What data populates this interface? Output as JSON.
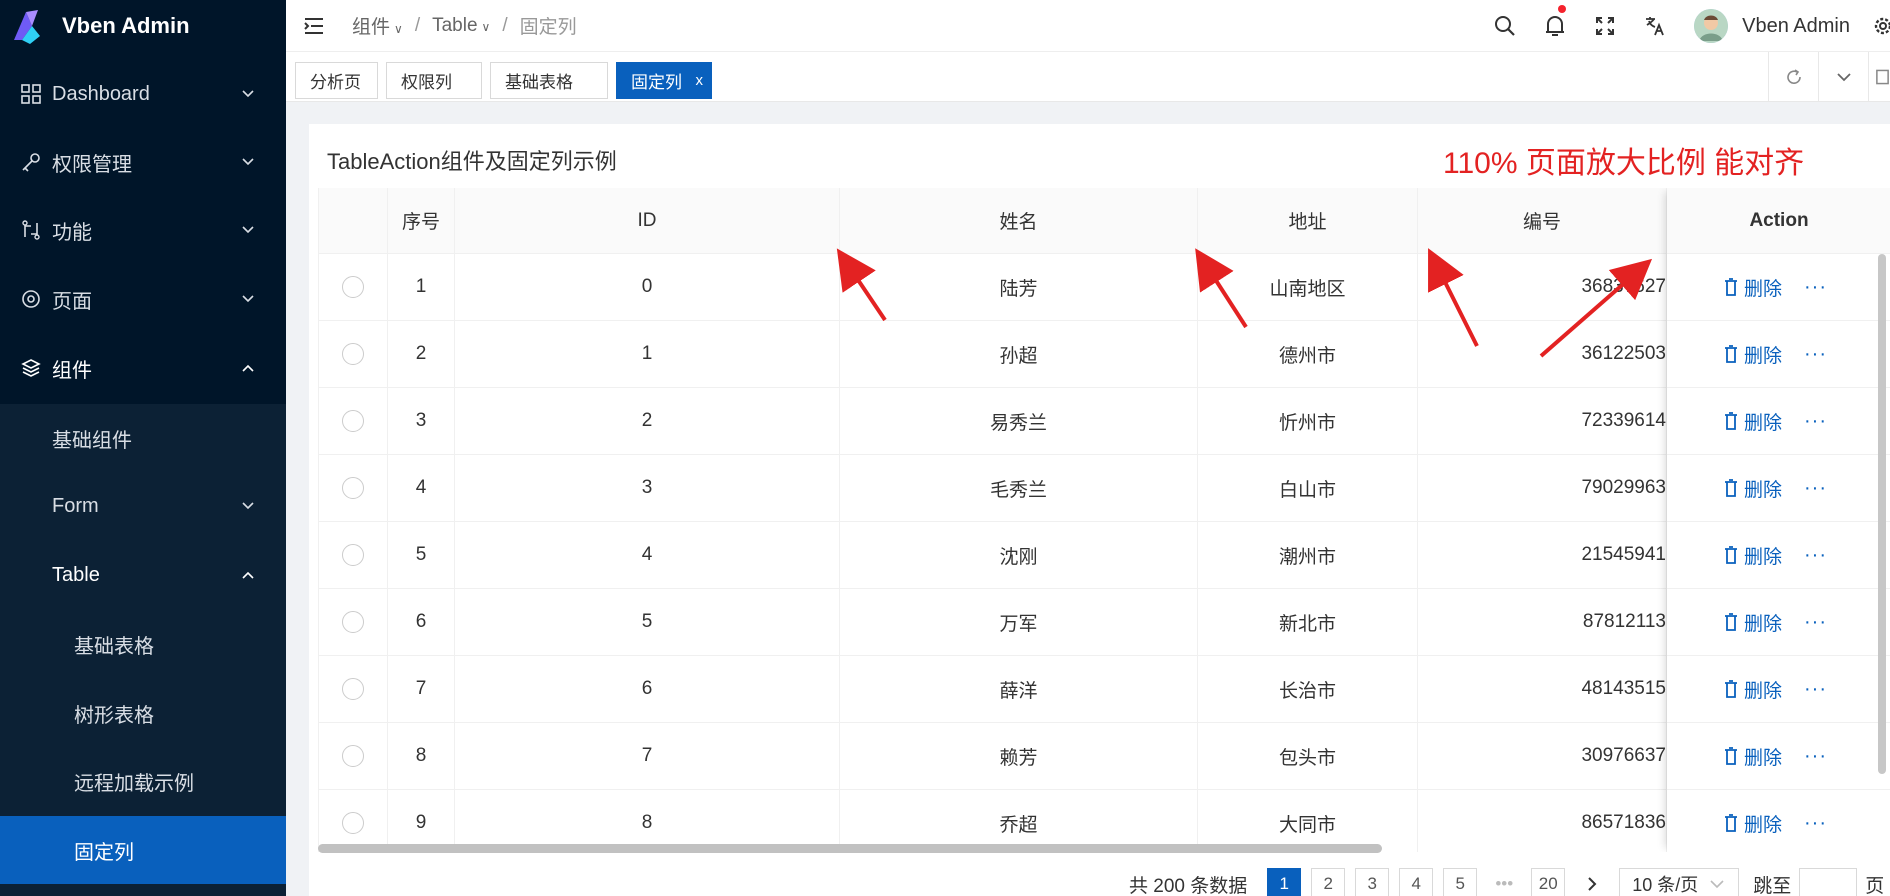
{
  "app": {
    "title": "Vben Admin"
  },
  "sidebar": {
    "items": [
      {
        "label": "Dashboard",
        "icon": "dashboard-icon"
      },
      {
        "label": "权限管理",
        "icon": "key-icon"
      },
      {
        "label": "功能",
        "icon": "function-icon"
      },
      {
        "label": "页面",
        "icon": "page-icon"
      },
      {
        "label": "组件",
        "icon": "layers-icon"
      },
      {
        "label": "基础组件"
      },
      {
        "label": "Form"
      },
      {
        "label": "Table"
      },
      {
        "label": "基础表格"
      },
      {
        "label": "树形表格"
      },
      {
        "label": "远程加载示例"
      },
      {
        "label": "固定列"
      }
    ]
  },
  "header": {
    "breadcrumb": [
      "组件",
      "Table",
      "固定列"
    ],
    "user": "Vben Admin"
  },
  "tabs": [
    {
      "label": "分析页"
    },
    {
      "label": "权限列"
    },
    {
      "label": "基础表格"
    },
    {
      "label": "固定列",
      "close": "x"
    }
  ],
  "card": {
    "title": "TableAction组件及固定列示例",
    "annotation": "110% 页面放大比例 能对齐"
  },
  "table": {
    "headers": [
      "序号",
      "ID",
      "姓名",
      "地址",
      "编号",
      "Action"
    ],
    "delete_label": "删除",
    "more_label": "···",
    "rows": [
      {
        "no": "1",
        "id": "0",
        "name": "陆芳",
        "addr": "山南地区",
        "code": "36837627"
      },
      {
        "no": "2",
        "id": "1",
        "name": "孙超",
        "addr": "德州市",
        "code": "36122503"
      },
      {
        "no": "3",
        "id": "2",
        "name": "易秀兰",
        "addr": "忻州市",
        "code": "72339614"
      },
      {
        "no": "4",
        "id": "3",
        "name": "毛秀兰",
        "addr": "白山市",
        "code": "79029963"
      },
      {
        "no": "5",
        "id": "4",
        "name": "沈刚",
        "addr": "潮州市",
        "code": "21545941"
      },
      {
        "no": "6",
        "id": "5",
        "name": "万军",
        "addr": "新北市",
        "code": "87812113"
      },
      {
        "no": "7",
        "id": "6",
        "name": "薛洋",
        "addr": "长治市",
        "code": "48143515"
      },
      {
        "no": "8",
        "id": "7",
        "name": "赖芳",
        "addr": "包头市",
        "code": "30976637"
      },
      {
        "no": "9",
        "id": "8",
        "name": "乔超",
        "addr": "大同市",
        "code": "86571836"
      }
    ]
  },
  "pager": {
    "total": "共 200 条数据",
    "pages": [
      "1",
      "2",
      "3",
      "4",
      "5",
      "•••",
      "20"
    ],
    "size": "10 条/页",
    "jump": "跳至",
    "page_unit": "页"
  },
  "colors": {
    "sidebar_bg": "#001529",
    "primary": "#0960bd",
    "annotation": "#e32222"
  }
}
